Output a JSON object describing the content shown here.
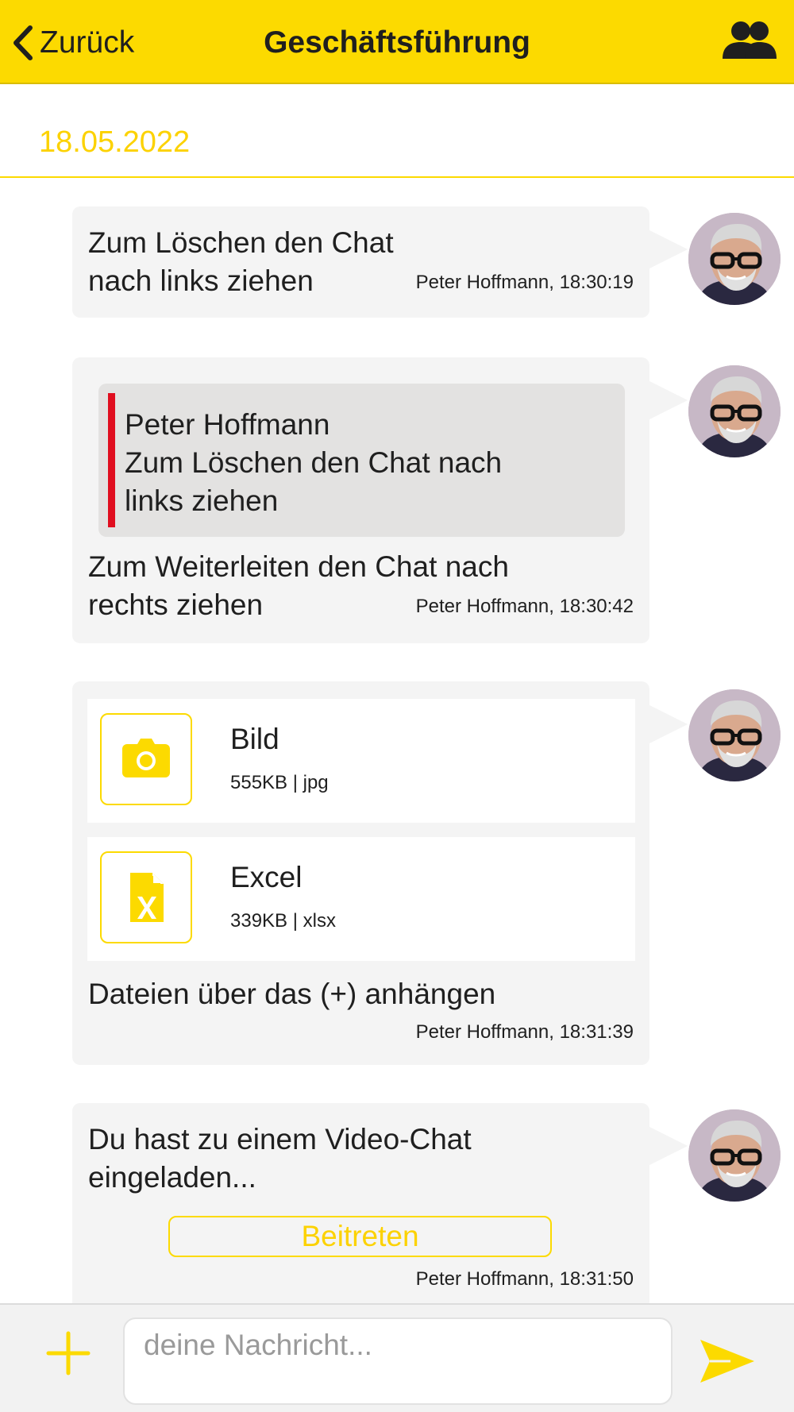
{
  "header": {
    "back_label": "Zurück",
    "title": "Geschäftsführung",
    "members_icon": "group-icon"
  },
  "date_separator": "18.05.2022",
  "messages": [
    {
      "text": "Zum Löschen den Chat nach links ziehen",
      "meta": "Peter Hoffmann, 18:30:19"
    },
    {
      "quote": {
        "author": "Peter Hoffmann",
        "text": "Zum Löschen den Chat nach links ziehen"
      },
      "text": "Zum Weiterleiten den Chat nach rechts ziehen",
      "meta": "Peter Hoffmann, 18:30:42"
    },
    {
      "files": [
        {
          "name": "Bild",
          "info": "555KB | jpg",
          "icon": "camera-icon"
        },
        {
          "name": "Excel",
          "info": "339KB | xlsx",
          "icon": "excel-file-icon"
        }
      ],
      "text": "Dateien über das (+) anhängen",
      "meta": "Peter Hoffmann, 18:31:39"
    },
    {
      "text": "Du hast zu einem Video-Chat eingeladen...",
      "button": "Beitreten",
      "meta": "Peter Hoffmann, 18:31:50"
    }
  ],
  "composer": {
    "placeholder": "deine Nachricht...",
    "value": ""
  },
  "colors": {
    "accent": "#fcda00",
    "quote_bar": "#e00e1f",
    "bubble": "#f4f4f4"
  }
}
